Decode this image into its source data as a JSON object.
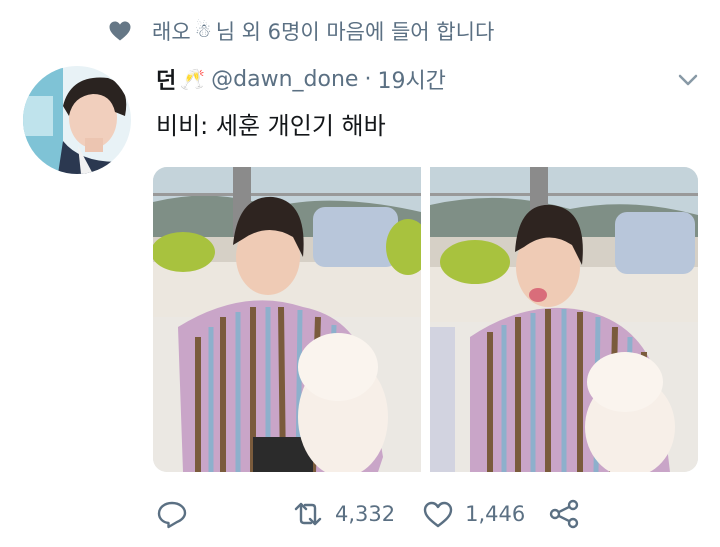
{
  "social_context": {
    "prefix": "래오",
    "suffix": "님 외 6명이 마음에 들어 합니다",
    "icon": "heart-icon",
    "emoji_icon": "snowman-emoji"
  },
  "tweet": {
    "display_name": "던",
    "name_emoji": "🥂",
    "handle": "@dawn_done",
    "separator": "·",
    "time": "19시간",
    "text": "비비: 세훈 개인기 해바"
  },
  "actions": {
    "reply_icon": "reply-icon",
    "retweet_icon": "retweet-icon",
    "retweets": "4,332",
    "like_icon": "like-icon",
    "likes": "1,446",
    "share_icon": "share-icon"
  },
  "colors": {
    "secondary_text": "#5b7083",
    "primary_text": "#14171a",
    "background": "#ffffff"
  }
}
